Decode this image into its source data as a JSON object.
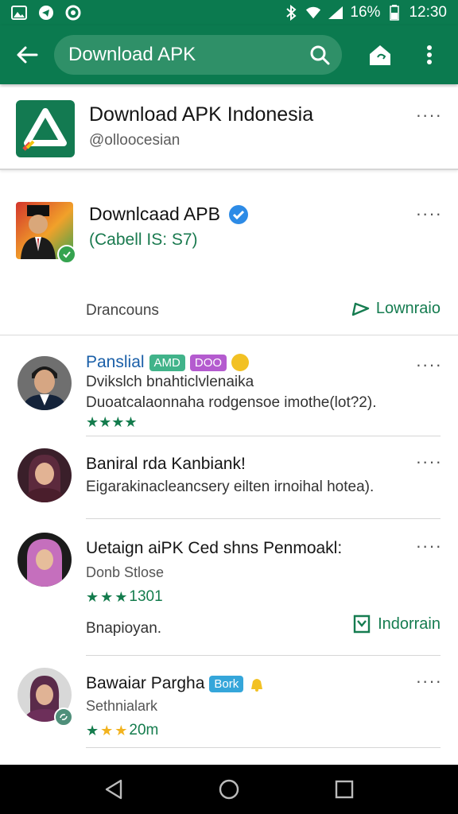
{
  "status_bar": {
    "left_icons": [
      "gallery-icon",
      "telegram-icon",
      "record-icon"
    ],
    "battery": "16%",
    "time": "12:30"
  },
  "app_bar": {
    "search_text": "Download APK"
  },
  "channel": {
    "name": "Download APK Indonesia",
    "handle": "@olloocesian",
    "more": "····"
  },
  "featured": {
    "title": "Downlcaad APB",
    "subtitle": "(Cabell IS: S7)",
    "left_label": "Drancouns",
    "right_label": "Lownraio",
    "more": "····"
  },
  "items": [
    {
      "title": "Panslial",
      "tags": [
        "AMD",
        "DOO"
      ],
      "line1": "Dvikslch bnahticlvlenaika",
      "line2": "Duoatcalaonnaha  rodgensoe imothe(lot?2).",
      "rating": "★★★★",
      "more": "····"
    },
    {
      "title": "Baniral rda Kanbiank!",
      "line1": "Eigarakinacleancsery eilten irnoihal hotea).",
      "more": "····"
    },
    {
      "title": "Uetaign aiPK Ced shns Penmoakl:",
      "line1": "Donb Stlose",
      "rating_text": "1301",
      "left_label": "Bnapioyan.",
      "right_label": "Indorrain",
      "more": "····"
    },
    {
      "title": "Bawaiar Pargha",
      "tag": "Bork",
      "line1": "Sethnialark",
      "rating_text": "20m",
      "more": "····"
    }
  ],
  "colors": {
    "brand_green": "#0b7a4f",
    "accent_green": "#147c4d",
    "link_blue": "#1a5fa8"
  }
}
